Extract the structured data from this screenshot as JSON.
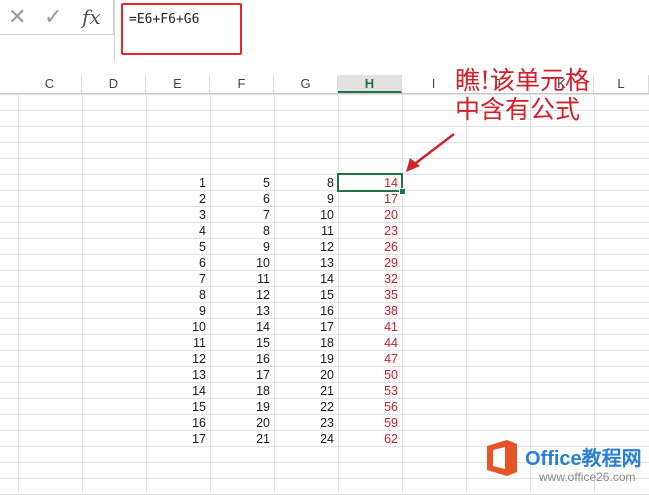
{
  "formula_bar": {
    "cancel_icon": "✕",
    "enter_icon": "✓",
    "fx_label": "fx",
    "formula": "=E6+F6+G6"
  },
  "columns": [
    "C",
    "D",
    "E",
    "F",
    "G",
    "H",
    "I",
    "J",
    "K",
    "L"
  ],
  "selected_column": "H",
  "rows": [
    {
      "e": "1",
      "f": "5",
      "g": "8",
      "h": "14"
    },
    {
      "e": "2",
      "f": "6",
      "g": "9",
      "h": "17"
    },
    {
      "e": "3",
      "f": "7",
      "g": "10",
      "h": "20"
    },
    {
      "e": "4",
      "f": "8",
      "g": "11",
      "h": "23"
    },
    {
      "e": "5",
      "f": "9",
      "g": "12",
      "h": "26"
    },
    {
      "e": "6",
      "f": "10",
      "g": "13",
      "h": "29"
    },
    {
      "e": "7",
      "f": "11",
      "g": "14",
      "h": "32"
    },
    {
      "e": "8",
      "f": "12",
      "g": "15",
      "h": "35"
    },
    {
      "e": "9",
      "f": "13",
      "g": "16",
      "h": "38"
    },
    {
      "e": "10",
      "f": "14",
      "g": "17",
      "h": "41"
    },
    {
      "e": "11",
      "f": "15",
      "g": "18",
      "h": "44"
    },
    {
      "e": "12",
      "f": "16",
      "g": "19",
      "h": "47"
    },
    {
      "e": "13",
      "f": "17",
      "g": "20",
      "h": "50"
    },
    {
      "e": "14",
      "f": "18",
      "g": "21",
      "h": "53"
    },
    {
      "e": "15",
      "f": "19",
      "g": "22",
      "h": "56"
    },
    {
      "e": "16",
      "f": "20",
      "g": "23",
      "h": "59"
    },
    {
      "e": "17",
      "f": "21",
      "g": "24",
      "h": "62"
    }
  ],
  "annotation": {
    "line1": "瞧!该单元格",
    "line2": "中含有公式"
  },
  "watermark": {
    "text": "Office教程网",
    "sub": "www.office26.com"
  },
  "colors": {
    "formula_highlight": "#e8262f",
    "selection": "#217346",
    "result_text": "#c8202a",
    "annotation": "#d4202a"
  }
}
